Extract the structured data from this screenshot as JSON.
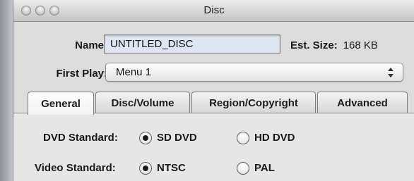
{
  "window": {
    "title": "Disc"
  },
  "fields": {
    "name_label": "Name:",
    "name_value": "UNTITLED_DISC",
    "est_size_label": "Est. Size:",
    "est_size_value": "168 KB",
    "first_play_label": "First Play:",
    "first_play_value": "Menu 1"
  },
  "tabs": [
    {
      "label": "General",
      "active": true
    },
    {
      "label": "Disc/Volume",
      "active": false
    },
    {
      "label": "Region/Copyright",
      "active": false
    },
    {
      "label": "Advanced",
      "active": false
    }
  ],
  "general": {
    "dvd_standard": {
      "label": "DVD Standard:",
      "options": [
        {
          "label": "SD DVD",
          "selected": true
        },
        {
          "label": "HD DVD",
          "selected": false
        }
      ]
    },
    "video_standard": {
      "label": "Video Standard:",
      "options": [
        {
          "label": "NTSC",
          "selected": true
        },
        {
          "label": "PAL",
          "selected": false
        }
      ]
    }
  },
  "icons": {
    "window_controls": [
      "close-icon",
      "minimize-icon",
      "zoom-icon"
    ],
    "popup_arrows": "up-down-arrows-icon"
  },
  "colors": {
    "window_bg": "#dcdcdc",
    "input_bg": "#dfe6f3"
  }
}
